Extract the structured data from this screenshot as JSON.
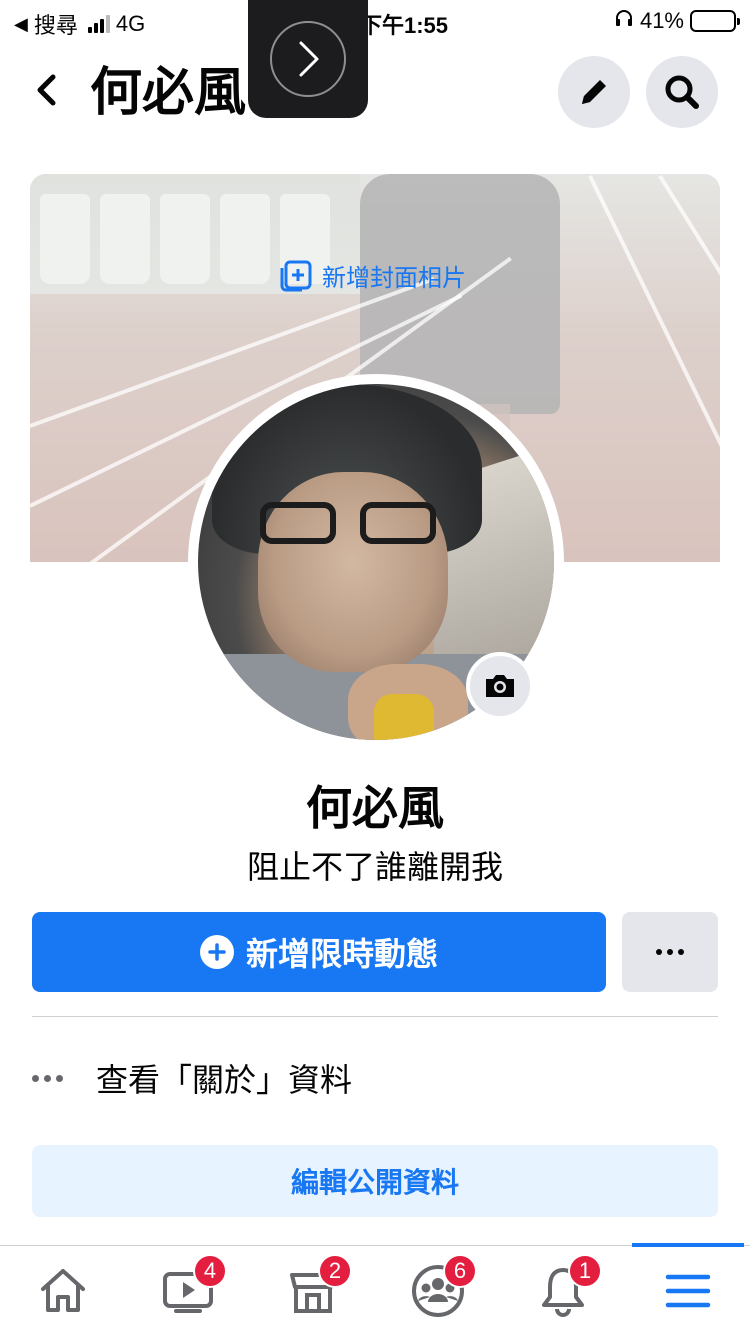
{
  "status_bar": {
    "back_app": "搜尋",
    "network": "4G",
    "time": "下午1:55",
    "battery": "41%",
    "battery_level": 0.41
  },
  "header": {
    "title": "何必風"
  },
  "cover": {
    "add_cover_label": "新增封面相片"
  },
  "profile": {
    "name": "何必風",
    "bio": "阻止不了誰離開我"
  },
  "actions": {
    "add_story_label": "新增限時動態"
  },
  "about": {
    "label": "查看「關於」資料"
  },
  "edit_public_label": "編輯公開資料",
  "tabs": [
    {
      "name": "home",
      "icon": "home-icon",
      "badge": ""
    },
    {
      "name": "watch",
      "icon": "video-icon",
      "badge": "4"
    },
    {
      "name": "marketplace",
      "icon": "store-icon",
      "badge": "2"
    },
    {
      "name": "groups",
      "icon": "groups-icon",
      "badge": "6"
    },
    {
      "name": "notifications",
      "icon": "bell-icon",
      "badge": "1"
    },
    {
      "name": "menu",
      "icon": "menu-icon",
      "badge": ""
    }
  ],
  "colors": {
    "accent": "#1877f2",
    "badge": "#e41e3f",
    "light_button": "#e4e6eb",
    "light_accent_bg": "#e7f3ff"
  }
}
